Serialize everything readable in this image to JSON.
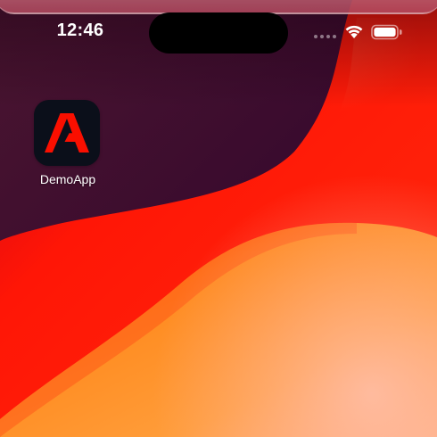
{
  "status_bar": {
    "time": "12:46",
    "icons": [
      "cellular-signal-icon",
      "wifi-icon",
      "battery-icon"
    ]
  },
  "home_screen": {
    "apps": [
      {
        "label": "DemoApp",
        "icon": "adobe-logo-icon"
      }
    ]
  },
  "colors": {
    "logo_red": "#fa0f00",
    "app_icon_background": "#0b0f1a",
    "wallpaper_dark": "#3a0b2e",
    "wallpaper_red": "#ff1a0a",
    "wallpaper_orange": "#ff9a20"
  }
}
